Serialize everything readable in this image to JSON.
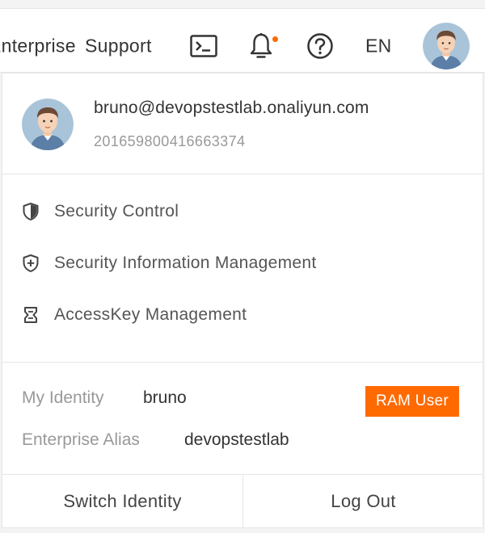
{
  "topbar": {
    "enterprise_label": "Enterprise",
    "support_label": "Support",
    "terminal_icon": "terminal-icon",
    "bell_icon": "bell-icon",
    "help_icon": "help-icon",
    "language": "EN",
    "notification_dot_color": "#ff6a00"
  },
  "user": {
    "email": "bruno@devopstestlab.onaliyun.com",
    "account_id": "201659800416663374"
  },
  "menu": {
    "items": [
      {
        "label": "Security Control",
        "icon": "shield-icon"
      },
      {
        "label": "Security Information Management",
        "icon": "shield-plus-icon"
      },
      {
        "label": "AccessKey Management",
        "icon": "key-icon"
      }
    ]
  },
  "identity": {
    "my_identity_label": "My Identity",
    "my_identity_value": "bruno",
    "enterprise_alias_label": "Enterprise Alias",
    "enterprise_alias_value": "devopstestlab",
    "badge": "RAM User",
    "badge_color": "#ff6a00"
  },
  "footer": {
    "switch_label": "Switch Identity",
    "logout_label": "Log Out"
  }
}
